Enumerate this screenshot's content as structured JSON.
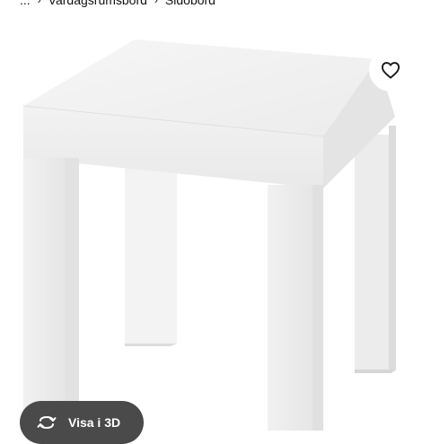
{
  "breadcrumb": {
    "items": [
      "...",
      "Vardagsrumsbord",
      "Sidobord"
    ]
  },
  "product": {
    "image_alt": "white side table"
  },
  "favorite": {
    "icon": "heart-icon"
  },
  "view3d": {
    "label": "Visa i 3D",
    "icon": "rotate-3d-icon"
  },
  "colors": {
    "background": "#ffffff",
    "pill_bg": "#4a4a4a",
    "pill_text": "#ffffff"
  }
}
